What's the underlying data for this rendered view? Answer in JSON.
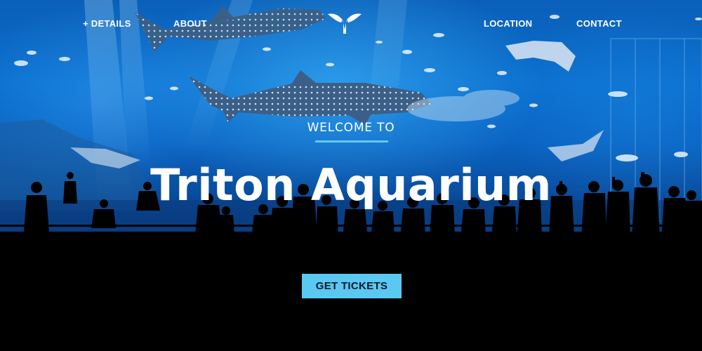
{
  "nav": {
    "details_label": "+ DETAILS",
    "about_label": "ABOUT",
    "location_label": "LOCATION",
    "contact_label": "CONTACT",
    "logo_icon": "whale-tail-icon"
  },
  "hero": {
    "welcome_text": "WELCOME TO",
    "headline": "Triton Aquarium"
  },
  "cta": {
    "label": "GET TICKETS"
  },
  "colors": {
    "accent": "#5bc8f2",
    "rule": "#63c9ef",
    "water": "#0b6fcf",
    "text": "#ffffff",
    "background": "#000000"
  }
}
